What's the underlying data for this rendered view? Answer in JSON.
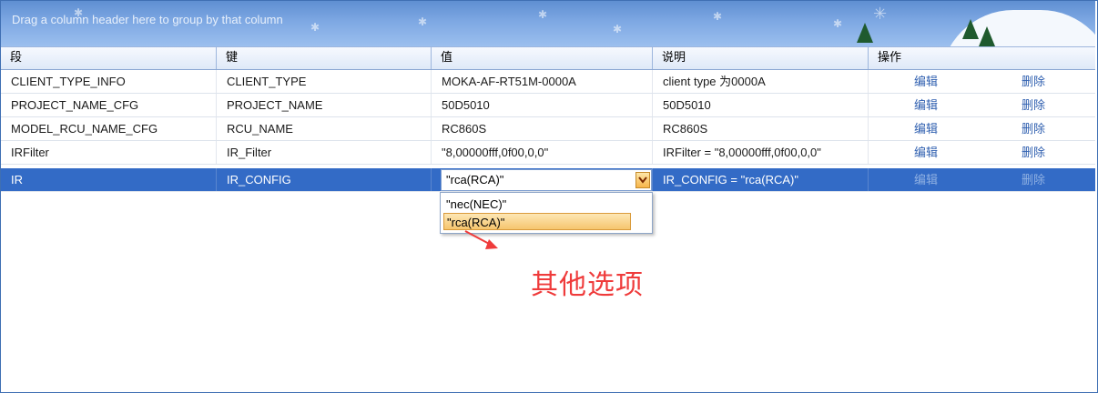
{
  "group_panel": {
    "hint": "Drag a column header here to group by that column"
  },
  "columns": [
    "段",
    "键",
    "值",
    "说明",
    "操作"
  ],
  "rows": [
    {
      "segment": "CLIENT_TYPE_INFO",
      "key": "CLIENT_TYPE",
      "value": "MOKA-AF-RT51M-0000A",
      "desc": "client type 为0000A",
      "edit": "编辑",
      "delete": "删除"
    },
    {
      "segment": "PROJECT_NAME_CFG",
      "key": "PROJECT_NAME",
      "value": "50D5010",
      "desc": "50D5010",
      "edit": "编辑",
      "delete": "删除"
    },
    {
      "segment": "MODEL_RCU_NAME_CFG",
      "key": "RCU_NAME",
      "value": "RC860S",
      "desc": "RC860S",
      "edit": "编辑",
      "delete": "删除"
    },
    {
      "segment": "IRFilter",
      "key": "IR_Filter",
      "value": "\"8,00000fff,0f00,0,0\"",
      "desc": "IRFilter = \"8,00000fff,0f00,0,0\"",
      "edit": "编辑",
      "delete": "删除"
    },
    {
      "segment": "IR",
      "key": "IR_CONFIG",
      "value": "\"rca(RCA)\"",
      "desc": "IR_CONFIG = \"rca(RCA)\"",
      "edit": "编辑",
      "delete": "删除"
    }
  ],
  "editor": {
    "current_value": "\"rca(RCA)\"",
    "options": [
      "\"nec(NEC)\"",
      "\"rca(RCA)\""
    ],
    "button_icon": "chevron-down-icon"
  },
  "annotation": {
    "text": "其他选项",
    "color": "#ef3b3b"
  },
  "colors": {
    "selected_row": "#336bc6",
    "link": "#3060b0",
    "header_gradient_top": "#5f8fd2"
  }
}
